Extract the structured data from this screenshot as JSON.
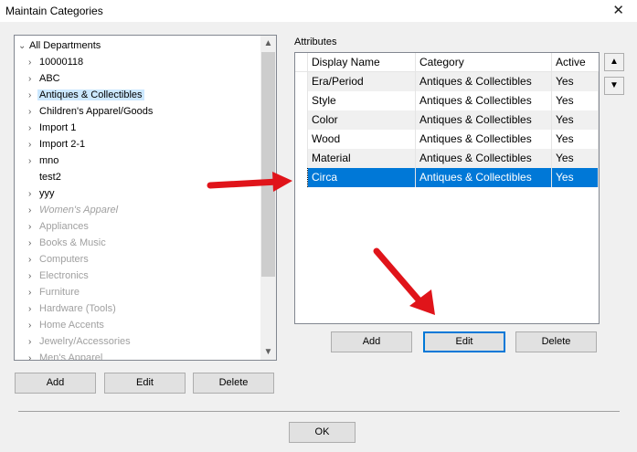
{
  "window": {
    "title": "Maintain Categories",
    "close_glyph": "✕"
  },
  "tree": {
    "root": "All Departments",
    "items": [
      {
        "label": "10000118",
        "enabled": true
      },
      {
        "label": "ABC",
        "enabled": true
      },
      {
        "label": "Antiques & Collectibles",
        "enabled": true,
        "selected": true
      },
      {
        "label": "Children's Apparel/Goods",
        "enabled": true
      },
      {
        "label": "Import 1",
        "enabled": true
      },
      {
        "label": "Import 2-1",
        "enabled": true
      },
      {
        "label": "mno",
        "enabled": true
      },
      {
        "label": "test2",
        "enabled": true,
        "leaf": true
      },
      {
        "label": "yyy",
        "enabled": true
      },
      {
        "label": "Women's Apparel",
        "enabled": false,
        "italic": true
      },
      {
        "label": "Appliances",
        "enabled": false
      },
      {
        "label": "Books & Music",
        "enabled": false
      },
      {
        "label": "Computers",
        "enabled": false
      },
      {
        "label": "Electronics",
        "enabled": false
      },
      {
        "label": "Furniture",
        "enabled": false
      },
      {
        "label": "Hardware (Tools)",
        "enabled": false
      },
      {
        "label": "Home Accents",
        "enabled": false
      },
      {
        "label": "Jewelry/Accessories",
        "enabled": false
      },
      {
        "label": "Men's Apparel",
        "enabled": false
      }
    ],
    "buttons": {
      "add": "Add",
      "edit": "Edit",
      "delete": "Delete"
    }
  },
  "attributes": {
    "label": "Attributes",
    "columns": [
      "Display Name",
      "Category",
      "Active"
    ],
    "rows": [
      {
        "name": "Era/Period",
        "category": "Antiques & Collectibles",
        "active": "Yes"
      },
      {
        "name": "Style",
        "category": "Antiques & Collectibles",
        "active": "Yes"
      },
      {
        "name": "Color",
        "category": "Antiques & Collectibles",
        "active": "Yes"
      },
      {
        "name": "Wood",
        "category": "Antiques & Collectibles",
        "active": "Yes"
      },
      {
        "name": "Material",
        "category": "Antiques & Collectibles",
        "active": "Yes"
      },
      {
        "name": "Circa",
        "category": "Antiques & Collectibles",
        "active": "Yes",
        "selected": true
      }
    ],
    "buttons": {
      "add": "Add",
      "edit": "Edit",
      "delete": "Delete"
    }
  },
  "footer": {
    "ok": "OK"
  },
  "colors": {
    "selection": "#0078d7",
    "annotation_arrow": "#e0141a"
  }
}
